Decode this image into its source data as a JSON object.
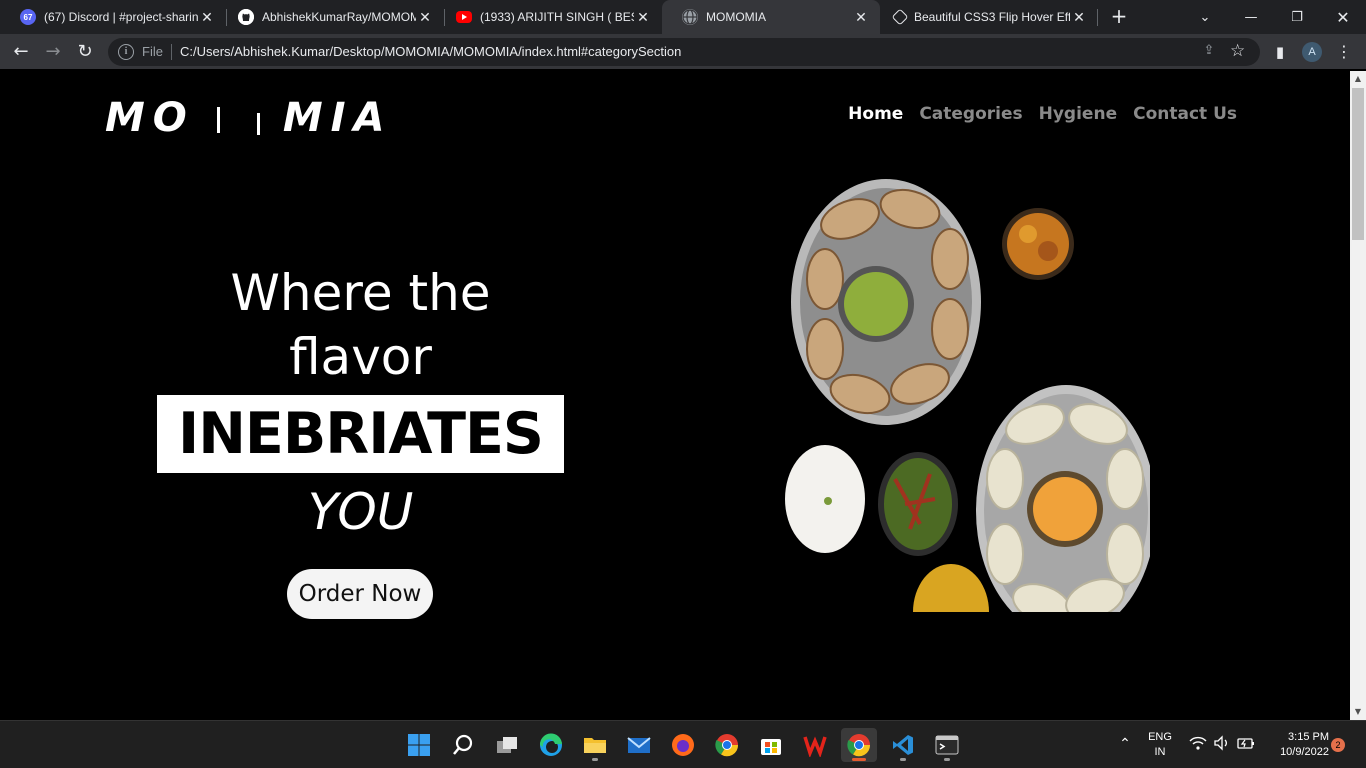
{
  "browser": {
    "tabs": [
      {
        "title": "(67) Discord | #project-sharin",
        "favicon": "discord-icon",
        "badge": "67"
      },
      {
        "title": "AbhishekKumarRay/MOMOM",
        "favicon": "github-icon"
      },
      {
        "title": "(1933) ARIJITH SINGH ( BEST",
        "favicon": "youtube-icon"
      },
      {
        "title": "MOMOMIA",
        "favicon": "globe-icon",
        "active": true
      },
      {
        "title": "Beautiful CSS3 Flip Hover Eff",
        "favicon": "codepen-icon"
      }
    ],
    "address": {
      "scheme_label": "File",
      "url": "C:/Users/Abhishek.Kumar/Desktop/MOMOMIA/MOMOMIA/index.html#categorySection"
    },
    "profile_initial": "A"
  },
  "site": {
    "logo_left": "MO",
    "logo_right": "MIA",
    "nav": [
      {
        "label": "Home",
        "active": true
      },
      {
        "label": "Categories"
      },
      {
        "label": "Hygiene"
      },
      {
        "label": "Contact Us"
      }
    ],
    "hero": {
      "line1": "Where the",
      "line2": "flavor",
      "highlight": "INEBRIATES",
      "line4": "YOU",
      "cta": "Order Now"
    }
  },
  "taskbar": {
    "apps": [
      "start-icon",
      "search-icon",
      "task-view-icon",
      "edge-icon",
      "file-explorer-icon",
      "mail-icon",
      "firefox-icon",
      "chrome-icon",
      "store-icon",
      "wps-icon",
      "chrome-active-icon",
      "vscode-icon",
      "terminal-icon"
    ],
    "language": {
      "line1": "ENG",
      "line2": "IN"
    },
    "time": "3:15 PM",
    "date": "10/9/2022",
    "notifications": "2"
  },
  "colors": {
    "page_bg": "#000000",
    "nav_active": "#ffffff",
    "nav_inactive": "#8a8a8a",
    "highlight_bg": "#ffffff",
    "accent_orange": "#e55b2f"
  }
}
